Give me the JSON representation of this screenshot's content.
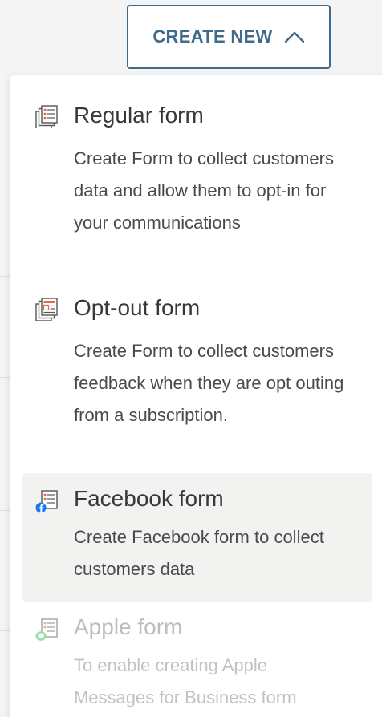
{
  "header": {
    "create_button_label": "CREATE NEW",
    "accent_color": "#3e6a8c"
  },
  "menu": {
    "items": [
      {
        "title": "Regular form",
        "description": "Create Form to collect customers data and allow them to opt-in for your communications",
        "icon": "regular-form-icon",
        "state": "normal"
      },
      {
        "title": "Opt-out form",
        "description": "Create Form to collect customers feedback when they are opt outing from a subscription.",
        "icon": "opt-out-form-icon",
        "state": "normal"
      },
      {
        "title": "Facebook form",
        "description": "Create Facebook form to collect customers data",
        "icon": "facebook-form-icon",
        "state": "highlighted"
      },
      {
        "title": "Apple form",
        "description": "To enable creating Apple Messages for Business form",
        "icon": "apple-form-icon",
        "state": "disabled"
      }
    ]
  }
}
